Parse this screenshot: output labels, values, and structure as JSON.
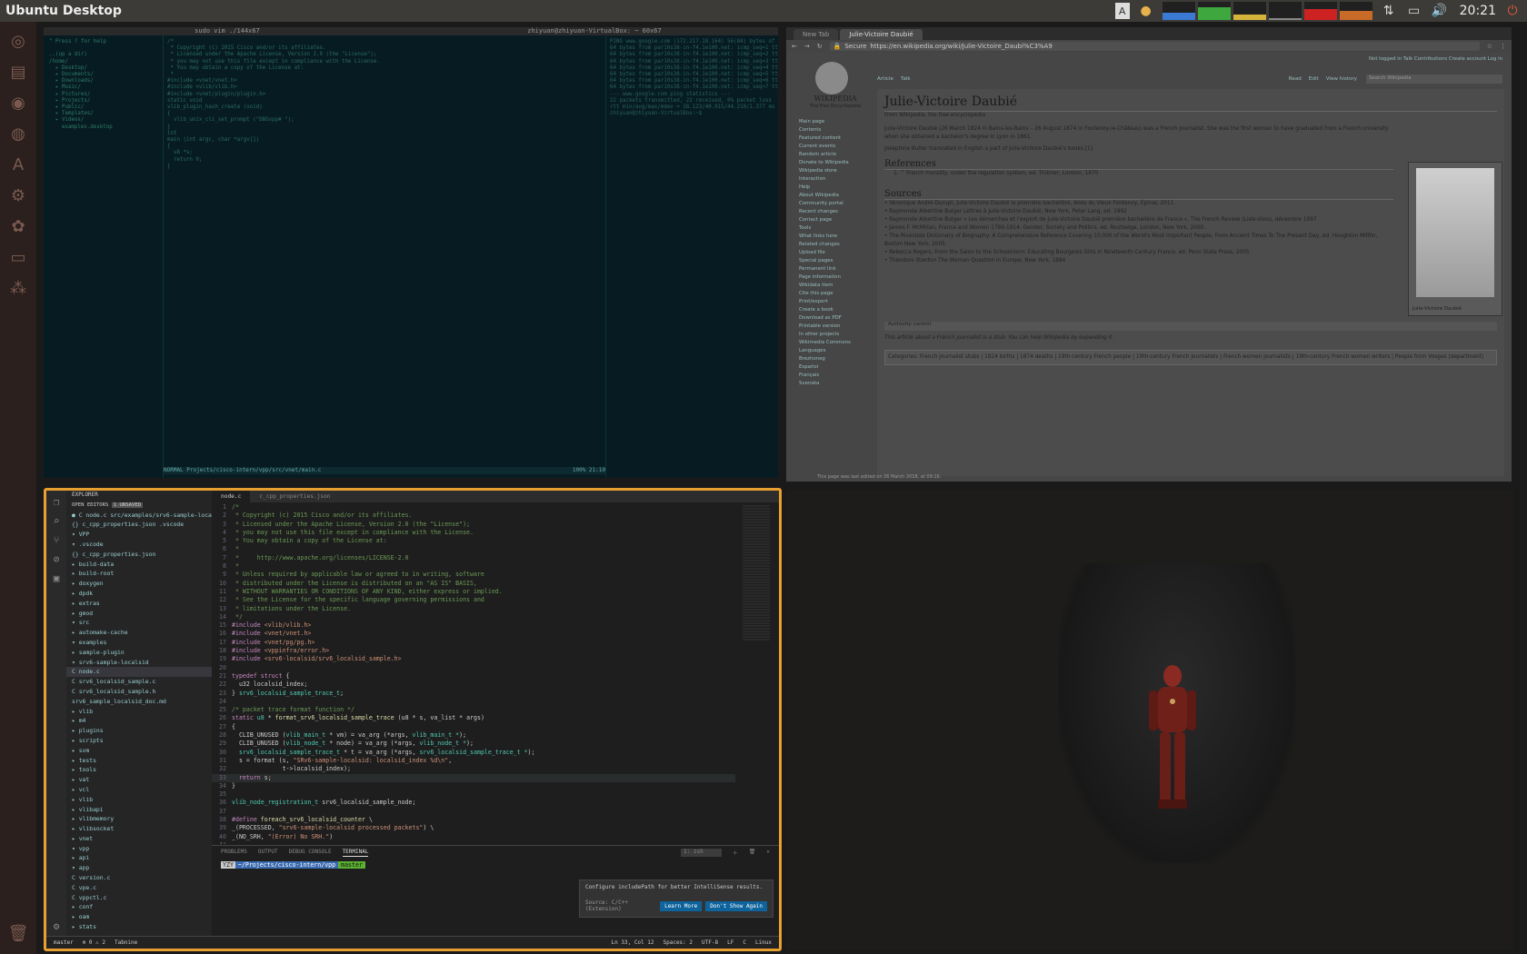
{
  "topbar": {
    "title": "Ubuntu Desktop",
    "clock": "20:21"
  },
  "launcher": {
    "items": [
      "ubuntu-logo",
      "files",
      "chrome",
      "browser",
      "text-editor",
      "settings",
      "software",
      "terminal",
      "network-tool"
    ]
  },
  "vim": {
    "title_left": "sudo vim ./144x67",
    "title_right": "zhiyuan@zhiyuan-VirtualBox: ~ 60x67",
    "tree_lines": [
      "\" Press ? for help",
      " ",
      "..(up a dir)",
      "/home/",
      "  ▸ Desktop/",
      "  ▸ Documents/",
      "  ▸ Downloads/",
      "  ▸ Music/",
      "  ▸ Pictures/",
      "  ▸ Projects/",
      "  ▸ Public/",
      "  ▸ Templates/",
      "  ▸ Videos/",
      "    examples.desktop"
    ],
    "code_lines": [
      "/*",
      " * Copyright (c) 2015 Cisco and/or its affiliates.",
      " * Licensed under the Apache License, Version 2.0 (the \"License\");",
      " * you may not use this file except in compliance with the License.",
      " * You may obtain a copy of the License at:",
      " *",
      "#include <vnet/vnet.h>",
      "#include <vlib/vlib.h>",
      "#include <vnet/plugin/plugin.h>",
      "",
      "static void",
      "vlib_plugin_hash_create (void)",
      "{",
      "  vlib_unix_cli_set_prompt (\"DBGvpp# \");",
      "}",
      "",
      "int",
      "main (int argc, char *argv[])",
      "{",
      "  u8 *s;",
      "  return 0;",
      "}"
    ],
    "ping_lines": [
      "PING www.google.com (172.217.18.164) 56(84) bytes of data.",
      "64 bytes from par10s38-in-f4.1e100.net: icmp_seq=1 ttl=63 time=40.4 ms",
      "64 bytes from par10s38-in-f4.1e100.net: icmp_seq=2 ttl=63 time=38.7 ms",
      "64 bytes from par10s38-in-f4.1e100.net: icmp_seq=3 ttl=63 time=41.2 ms",
      "64 bytes from par10s38-in-f4.1e100.net: icmp_seq=4 ttl=63 time=39.9 ms",
      "64 bytes from par10s38-in-f4.1e100.net: icmp_seq=5 ttl=63 time=40.1 ms",
      "64 bytes from par10s38-in-f4.1e100.net: icmp_seq=6 ttl=63 time=38.5 ms",
      "64 bytes from par10s38-in-f4.1e100.net: icmp_seq=7 ttl=63 time=40.8 ms",
      "--- www.google.com ping statistics ---",
      "22 packets transmitted, 22 received, 0% packet loss",
      "rtt min/avg/max/mdev = 38.123/40.015/44.210/1.377 ms",
      "zhiyuan@zhiyuan-VirtualBox:~$ "
    ],
    "status": "NORMAL  Projects/cisco-intern/vpp/src/vnet/main.c",
    "status_right": "100%  21:10"
  },
  "browser": {
    "tabs": [
      "New Tab",
      "Julie-Victoire Daubié"
    ],
    "secure": "Secure",
    "url": "https://en.wikipedia.org/wiki/Julie-Victoire_Daubi%C3%A9",
    "logo": "WIKIPEDIA",
    "logo_sub": "The Free Encyclopedia",
    "sidebar": [
      "Main page",
      "Contents",
      "Featured content",
      "Current events",
      "Random article",
      "Donate to Wikipedia",
      "Wikipedia store",
      "",
      "Interaction",
      "Help",
      "About Wikipedia",
      "Community portal",
      "Recent changes",
      "Contact page",
      "",
      "Tools",
      "What links here",
      "Related changes",
      "Upload file",
      "Special pages",
      "Permanent link",
      "Page information",
      "Wikidata item",
      "Cite this page",
      "",
      "Print/export",
      "Create a book",
      "Download as PDF",
      "Printable version",
      "",
      "In other projects",
      "Wikimedia Commons",
      "",
      "Languages",
      "Brezhoneg",
      "Español",
      "Français",
      "Svenska"
    ],
    "article_title": "Julie-Victoire Daubié",
    "from": "From Wikipedia, the free encyclopedia",
    "intro": "Julie-Victoire Daubié (26 March 1824 in Bains-les-Bains – 26 August 1874 in Fontenoy-le-Château) was a French journalist. She was the first woman to have graduated from a French university when she obtained a bachelor's degree in Lyon in 1861.",
    "intro2": "Josephine Butler translated in English a part of Julie-Victoire Daubié's books.[1]",
    "refs_heading": "References",
    "ref1": "1. ^ French morality, under the regulation system, ed. Trübner, London, 1870",
    "sources_heading": "Sources",
    "sources": [
      "Véronique André-Durupt, Julie-Victoire Daubié la première bachelière, Amis du Vieux Fontenoy, Épinal, 2011.",
      "Raymonde Albertine Bulger Lettres à Julie-Victoire Daubié, New York, Peter Lang, ed. 1992",
      "Raymonde Albertine Bulger « Les démarches et l'exploit de Julie-Victoire Daubié première bachelière de France », The French Review (Lisle-Visio), décembre 1997",
      "James F. McMillan, France and Women 1789-1914: Gender, Society and Politics, ed. Routledge, London, New York, 2000.",
      "The Riverside Dictionary of Biography: A Comprehensive Reference Covering 10,000 of the World's Most Important People, From Ancient Times To The Present Day, ed. Houghton Mifflin, Boston New York, 2005.",
      "Rebecca Rogers, From the Salon to the Schoolroom: Educating Bourgeois Girls in Nineteenth-Century France, ed. Penn State Press, 2005",
      "Théodore Stanton The Woman Question in Europe, New York, 1884"
    ],
    "caption": "Julie-Victoire Daubié",
    "stub": "This article about a French journalist is a stub. You can help Wikipedia by expanding it.",
    "categories": "Categories: French journalist stubs | 1824 births | 1874 deaths | 19th-century French people | 19th-century French journalists | French women journalists | 19th-century French women writers | People from Vosges (department)",
    "authority": "Authority control",
    "footer": "This page was last edited on 26 March 2018, at 09:16.",
    "top_links": "Not logged in  Talk  Contributions  Create account  Log in",
    "page_tabs": [
      "Article",
      "Talk"
    ],
    "view_tabs": [
      "Read",
      "Edit",
      "View history"
    ],
    "search_placeholder": "Search Wikipedia"
  },
  "vscode": {
    "explorer": "EXPLORER",
    "open_editors": "OPEN EDITORS",
    "unsaved": "1 UNSAVED",
    "tree": [
      "● C node.c  src/examples/srv6-sample-localsid",
      "{} c_cpp_properties.json  .vscode",
      "▾ VPP",
      "  ▾ .vscode",
      "    {} c_cpp_properties.json",
      "  ▸ build-data",
      "  ▸ build-root",
      "  ▸ doxygen",
      "  ▸ dpdk",
      "  ▸ extras",
      "  ▸ gmod",
      "  ▾ src",
      "    ▸ automake-cache",
      "    ▾ examples",
      "      ▸ sample-plugin",
      "      ▾ srv6-sample-localsid",
      "        C node.c",
      "        C srv6_localsid_sample.c",
      "        C srv6_localsid_sample.h",
      "        srv6_sample_localsid_doc.md",
      "      ▸ vlib",
      "    ▸ m4",
      "    ▸ plugins",
      "    ▸ scripts",
      "    ▸ svm",
      "    ▸ tests",
      "    ▸ tools",
      "    ▸ vat",
      "    ▸ vcl",
      "    ▸ vlib",
      "    ▸ vlibapi",
      "    ▸ vlibmemory",
      "    ▸ vlibsocket",
      "    ▸ vnet",
      "    ▾ vpp",
      "      ▸ api",
      "      ▾ app",
      "        C version.c",
      "        C vpe.c",
      "        C vppctl.c",
      "      ▸ conf",
      "      ▸ oam",
      "      ▸ stats"
    ],
    "tabs": [
      "node.c",
      "c_cpp_properties.json"
    ],
    "panel_tabs": [
      "PROBLEMS",
      "OUTPUT",
      "DEBUG CONSOLE",
      "TERMINAL"
    ],
    "terminal_prompt": "YZY",
    "terminal_path": "~/Projects/cisco-intern/vpp",
    "terminal_branch": "master",
    "shell": "1: zsh",
    "notif_text": "Configure includePath for better IntelliSense results.",
    "notif_source": "Source: C/C++ (Extension)",
    "notif_btn1": "Learn More",
    "notif_btn2": "Don't Show Again",
    "status": [
      "master",
      "⊗ 0 ⚠ 2",
      "Tabnine",
      "Ln 33, Col 12",
      "Spaces: 2",
      "UTF-8",
      "LF",
      "C",
      "Linux"
    ]
  },
  "code": [
    [
      {
        "c": "cm",
        "t": "/*"
      }
    ],
    [
      {
        "c": "cm",
        "t": " * Copyright (c) 2015 Cisco and/or its affiliates."
      }
    ],
    [
      {
        "c": "cm",
        "t": " * Licensed under the Apache License, Version 2.0 (the \"License\");"
      }
    ],
    [
      {
        "c": "cm",
        "t": " * you may not use this file except in compliance with the License."
      }
    ],
    [
      {
        "c": "cm",
        "t": " * You may obtain a copy of the License at:"
      }
    ],
    [
      {
        "c": "cm",
        "t": " *"
      }
    ],
    [
      {
        "c": "cm",
        "t": " *     http://www.apache.org/licenses/LICENSE-2.0"
      }
    ],
    [
      {
        "c": "cm",
        "t": " *"
      }
    ],
    [
      {
        "c": "cm",
        "t": " * Unless required by applicable law or agreed to in writing, software"
      }
    ],
    [
      {
        "c": "cm",
        "t": " * distributed under the License is distributed on an \"AS IS\" BASIS,"
      }
    ],
    [
      {
        "c": "cm",
        "t": " * WITHOUT WARRANTIES OR CONDITIONS OF ANY KIND, either express or implied."
      }
    ],
    [
      {
        "c": "cm",
        "t": " * See the License for the specific language governing permissions and"
      }
    ],
    [
      {
        "c": "cm",
        "t": " * limitations under the License."
      }
    ],
    [
      {
        "c": "cm",
        "t": " */"
      }
    ],
    [
      {
        "c": "pp",
        "t": "#include "
      },
      {
        "c": "st",
        "t": "<vlib/vlib.h>"
      }
    ],
    [
      {
        "c": "pp",
        "t": "#include "
      },
      {
        "c": "st",
        "t": "<vnet/vnet.h>"
      }
    ],
    [
      {
        "c": "pp",
        "t": "#include "
      },
      {
        "c": "st",
        "t": "<vnet/pg/pg.h>"
      }
    ],
    [
      {
        "c": "pp",
        "t": "#include "
      },
      {
        "c": "st",
        "t": "<vppinfra/error.h>"
      }
    ],
    [
      {
        "c": "pp",
        "t": "#include "
      },
      {
        "c": "st",
        "t": "<srv6-localsid/srv6_localsid_sample.h>"
      }
    ],
    [
      {
        "c": "",
        "t": ""
      }
    ],
    [
      {
        "c": "kw",
        "t": "typedef struct "
      },
      {
        "c": "",
        "t": "{"
      }
    ],
    [
      {
        "c": "",
        "t": "  u32 localsid_index;"
      }
    ],
    [
      {
        "c": "",
        "t": "} "
      },
      {
        "c": "ty",
        "t": "srv6_localsid_sample_trace_t"
      },
      {
        "c": "",
        "t": ";"
      }
    ],
    [
      {
        "c": "",
        "t": ""
      }
    ],
    [
      {
        "c": "cm",
        "t": "/* packet trace format function */"
      }
    ],
    [
      {
        "c": "kw",
        "t": "static "
      },
      {
        "c": "ty",
        "t": "u8 "
      },
      {
        "c": "",
        "t": "* "
      },
      {
        "c": "fn",
        "t": "format_srv6_localsid_sample_trace"
      },
      {
        "c": "",
        "t": " (u8 * s, va_list * args)"
      }
    ],
    [
      {
        "c": "",
        "t": "{"
      }
    ],
    [
      {
        "c": "",
        "t": "  CLIB_UNUSED ("
      },
      {
        "c": "ty",
        "t": "vlib_main_t"
      },
      {
        "c": "",
        "t": " * vm) = va_arg (*args, "
      },
      {
        "c": "ty",
        "t": "vlib_main_t *"
      },
      {
        "c": "",
        "t": ");"
      }
    ],
    [
      {
        "c": "",
        "t": "  CLIB_UNUSED ("
      },
      {
        "c": "ty",
        "t": "vlib_node_t"
      },
      {
        "c": "",
        "t": " * node) = va_arg (*args, "
      },
      {
        "c": "ty",
        "t": "vlib_node_t *"
      },
      {
        "c": "",
        "t": ");"
      }
    ],
    [
      {
        "c": "",
        "t": "  "
      },
      {
        "c": "ty",
        "t": "srv6_localsid_sample_trace_t"
      },
      {
        "c": "",
        "t": " * t = va_arg (*args, "
      },
      {
        "c": "ty",
        "t": "srv6_localsid_sample_trace_t *"
      },
      {
        "c": "",
        "t": ");"
      }
    ],
    [
      {
        "c": "",
        "t": "  s = format (s, "
      },
      {
        "c": "st",
        "t": "\"SRv6-sample-localsid: localsid_index %d\\n\""
      },
      {
        "c": "",
        "t": ","
      }
    ],
    [
      {
        "c": "",
        "t": "              t->localsid_index);"
      }
    ],
    [
      {
        "c": "kw",
        "t": "  return "
      },
      {
        "c": "",
        "t": "s;"
      }
    ],
    [
      {
        "c": "",
        "t": "}"
      }
    ],
    [
      {
        "c": "",
        "t": ""
      }
    ],
    [
      {
        "c": "ty",
        "t": "vlib_node_registration_t"
      },
      {
        "c": "",
        "t": " srv6_localsid_sample_node;"
      }
    ],
    [
      {
        "c": "",
        "t": ""
      }
    ],
    [
      {
        "c": "pp",
        "t": "#define "
      },
      {
        "c": "fn",
        "t": "foreach_srv6_localsid_counter"
      },
      {
        "c": "",
        "t": " \\"
      }
    ],
    [
      {
        "c": "",
        "t": "_(PROCESSED, "
      },
      {
        "c": "st",
        "t": "\"srv6-sample-localsid processed packets\""
      },
      {
        "c": "",
        "t": ") \\"
      }
    ],
    [
      {
        "c": "",
        "t": "_(NO_SRH, "
      },
      {
        "c": "st",
        "t": "\"(Error) No SRH.\""
      },
      {
        "c": "",
        "t": ")"
      }
    ],
    [
      {
        "c": "",
        "t": ""
      }
    ],
    [
      {
        "c": "kw",
        "t": "typedef enum "
      },
      {
        "c": "",
        "t": "{"
      }
    ]
  ]
}
